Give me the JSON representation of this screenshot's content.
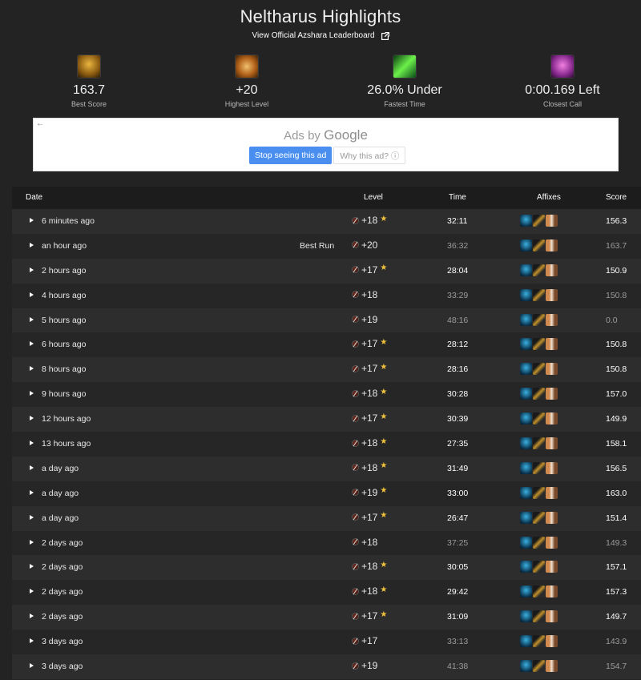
{
  "header": {
    "title": "Neltharus Highlights",
    "leaderboard_link": "View Official Azshara Leaderboard"
  },
  "stats": [
    {
      "icon": "best-score-icon",
      "value": "163.7",
      "label": "Best Score"
    },
    {
      "icon": "highest-level-icon",
      "value": "+20",
      "label": "Highest Level"
    },
    {
      "icon": "fastest-time-icon",
      "value": "26.0% Under",
      "label": "Fastest Time"
    },
    {
      "icon": "closest-call-icon",
      "value": "0:00.169 Left",
      "label": "Closest Call"
    }
  ],
  "ad": {
    "title_prefix": "Ads by",
    "title_brand": "Google",
    "stop_label": "Stop seeing this ad",
    "why_label": "Why this ad? ⓘ"
  },
  "table": {
    "headers": {
      "date": "Date",
      "level": "Level",
      "time": "Time",
      "affixes": "Affixes",
      "score": "Score"
    },
    "best_run_label": "Best Run",
    "rows": [
      {
        "date": "6 minutes ago",
        "best": "",
        "level": "+18",
        "star": "★",
        "time": "32:11",
        "score": "156.3",
        "timed": true
      },
      {
        "date": "an hour ago",
        "best": "Best Run",
        "level": "+20",
        "star": "",
        "time": "36:32",
        "score": "163.7",
        "timed": false
      },
      {
        "date": "2 hours ago",
        "best": "",
        "level": "+17",
        "star": "★",
        "time": "28:04",
        "score": "150.9",
        "timed": true
      },
      {
        "date": "4 hours ago",
        "best": "",
        "level": "+18",
        "star": "",
        "time": "33:29",
        "score": "150.8",
        "timed": false
      },
      {
        "date": "5 hours ago",
        "best": "",
        "level": "+19",
        "star": "",
        "time": "48:16",
        "score": "0.0",
        "timed": false
      },
      {
        "date": "6 hours ago",
        "best": "",
        "level": "+17",
        "star": "★",
        "time": "28:12",
        "score": "150.8",
        "timed": true
      },
      {
        "date": "8 hours ago",
        "best": "",
        "level": "+17",
        "star": "★",
        "time": "28:16",
        "score": "150.8",
        "timed": true
      },
      {
        "date": "9 hours ago",
        "best": "",
        "level": "+18",
        "star": "★",
        "time": "30:28",
        "score": "157.0",
        "timed": true
      },
      {
        "date": "12 hours ago",
        "best": "",
        "level": "+17",
        "star": "★",
        "time": "30:39",
        "score": "149.9",
        "timed": true
      },
      {
        "date": "13 hours ago",
        "best": "",
        "level": "+18",
        "star": "★",
        "time": "27:35",
        "score": "158.1",
        "timed": true
      },
      {
        "date": "a day ago",
        "best": "",
        "level": "+18",
        "star": "★",
        "time": "31:49",
        "score": "156.5",
        "timed": true
      },
      {
        "date": "a day ago",
        "best": "",
        "level": "+19",
        "star": "★",
        "time": "33:00",
        "score": "163.0",
        "timed": true
      },
      {
        "date": "a day ago",
        "best": "",
        "level": "+17",
        "star": "★",
        "time": "26:47",
        "score": "151.4",
        "timed": true
      },
      {
        "date": "2 days ago",
        "best": "",
        "level": "+18",
        "star": "",
        "time": "37:25",
        "score": "149.3",
        "timed": false
      },
      {
        "date": "2 days ago",
        "best": "",
        "level": "+18",
        "star": "★",
        "time": "30:05",
        "score": "157.1",
        "timed": true
      },
      {
        "date": "2 days ago",
        "best": "",
        "level": "+18",
        "star": "★",
        "time": "29:42",
        "score": "157.3",
        "timed": true
      },
      {
        "date": "2 days ago",
        "best": "",
        "level": "+17",
        "star": "★",
        "time": "31:09",
        "score": "149.7",
        "timed": true
      },
      {
        "date": "3 days ago",
        "best": "",
        "level": "+17",
        "star": "",
        "time": "33:13",
        "score": "143.9",
        "timed": false
      },
      {
        "date": "3 days ago",
        "best": "",
        "level": "+19",
        "star": "",
        "time": "41:38",
        "score": "154.7",
        "timed": false
      }
    ]
  },
  "colors": {
    "timed": "#ffffff",
    "depleted": "#9b9b9b",
    "star": "#f0c23c",
    "ad_button": "#4a8ff0"
  }
}
